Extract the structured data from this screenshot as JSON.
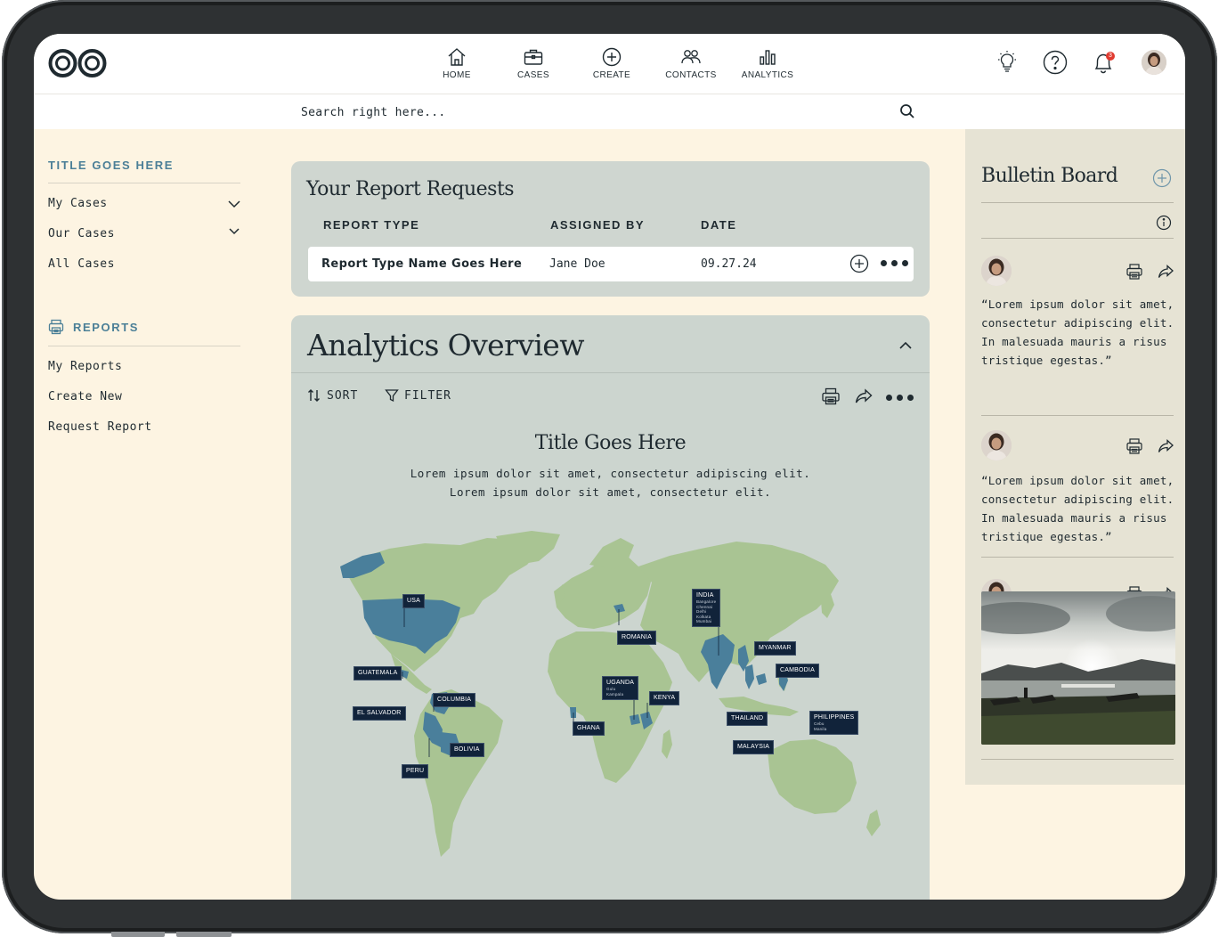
{
  "nav": {
    "items": [
      {
        "label": "HOME",
        "icon": "home-icon"
      },
      {
        "label": "CASES",
        "icon": "briefcase-icon"
      },
      {
        "label": "CREATE",
        "icon": "plus-circle-icon"
      },
      {
        "label": "CONTACTS",
        "icon": "people-icon"
      },
      {
        "label": "ANALYTICS",
        "icon": "bar-chart-icon"
      }
    ],
    "notification_count": "3",
    "top_icons": [
      "lightbulb-icon",
      "help-icon",
      "bell-icon",
      "avatar"
    ]
  },
  "search": {
    "placeholder": "Search right here..."
  },
  "sidebar": {
    "heading": "TITLE GOES HERE",
    "items": [
      "My Cases",
      "Our Cases",
      "All Cases"
    ],
    "reports_heading": "REPORTS",
    "report_items": [
      "My Reports",
      "Create New",
      "Request Report"
    ]
  },
  "requests": {
    "title": "Your Report Requests",
    "columns": [
      "REPORT TYPE",
      "ASSIGNED BY",
      "DATE"
    ],
    "rows": [
      {
        "type": "Report Type Name Goes Here",
        "assigned_by": "Jane Doe",
        "date": "09.27.24"
      }
    ]
  },
  "analytics": {
    "title": "Analytics Overview",
    "sort_label": "SORT",
    "filter_label": "FILTER",
    "chart_title": "Title Goes Here",
    "chart_subtitle_1": "Lorem ipsum dolor sit amet, consectetur adipiscing elit.",
    "chart_subtitle_2": "Lorem ipsum dolor sit amet, consectetur elit.",
    "map_labels": {
      "usa": "USA",
      "guatemala": "GUATEMALA",
      "el_salvador": "EL SALVADOR",
      "columbia": "COLUMBIA",
      "bolivia": "BOLIVIA",
      "peru": "PERU",
      "romania": "ROMANIA",
      "uganda": "UGANDA",
      "uganda_cities": [
        "Gulu",
        "Kampala"
      ],
      "ghana": "GHANA",
      "kenya": "KENYA",
      "india": "INDIA",
      "india_cities": [
        "Bangalore",
        "Chennai",
        "Delhi",
        "Kolkata",
        "Mumbai"
      ],
      "myanmar": "MYANMAR",
      "cambodia": "CAMBODIA",
      "thailand": "THAILAND",
      "malaysia": "MALAYSIA",
      "philippines": "PHILIPPINES",
      "philippines_cities": [
        "Cebu",
        "Manila"
      ]
    },
    "colors": {
      "land": "#a9c493",
      "highlight": "#4a7f9b",
      "ocean": "#ccd5cf",
      "label_bg": "#11233a"
    }
  },
  "bulletin": {
    "title": "Bulletin Board",
    "posts": [
      {
        "text": "“Lorem ipsum dolor sit amet, consectetur adipiscing elit. In malesuada mauris a risus tristique egestas.”"
      },
      {
        "text": "“Lorem ipsum dolor sit amet, consectetur adipiscing elit. In malesuada mauris a risus tristique egestas.”"
      }
    ]
  }
}
